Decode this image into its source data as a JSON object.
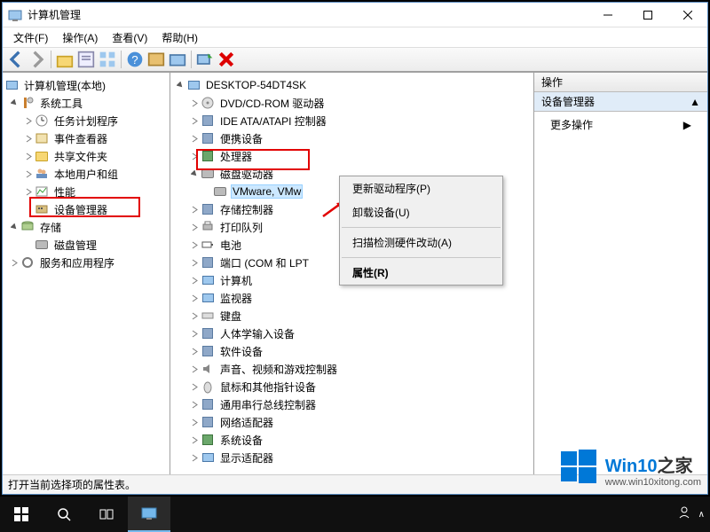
{
  "window": {
    "title": "计算机管理"
  },
  "menubar": [
    "文件(F)",
    "操作(A)",
    "查看(V)",
    "帮助(H)"
  ],
  "left_tree": {
    "root": "计算机管理(本地)",
    "system_tools": {
      "label": "系统工具",
      "children": [
        "任务计划程序",
        "事件查看器",
        "共享文件夹",
        "本地用户和组",
        "性能",
        "设备管理器"
      ]
    },
    "storage": {
      "label": "存储",
      "children": [
        "磁盘管理"
      ]
    },
    "services": "服务和应用程序"
  },
  "mid_tree": {
    "root": "DESKTOP-54DT4SK",
    "items": [
      "DVD/CD-ROM 驱动器",
      "IDE ATA/ATAPI 控制器",
      "便携设备",
      "处理器",
      "磁盘驱动器",
      "存储控制器",
      "打印队列",
      "电池",
      "端口 (COM 和 LPT",
      "计算机",
      "监视器",
      "键盘",
      "人体学输入设备",
      "软件设备",
      "声音、视频和游戏控制器",
      "鼠标和其他指针设备",
      "通用串行总线控制器",
      "网络适配器",
      "系统设备",
      "显示适配器"
    ],
    "disk_child": "VMware, VMw"
  },
  "context_menu": {
    "items": [
      "更新驱动程序(P)",
      "卸载设备(U)",
      "扫描检测硬件改动(A)",
      "属性(R)"
    ]
  },
  "actions": {
    "header": "操作",
    "sub": "设备管理器",
    "item": "更多操作"
  },
  "statusbar": "打开当前选择项的属性表。",
  "watermark": {
    "brand": "Win10",
    "suffix": "之家",
    "url": "www.win10xitong.com"
  }
}
